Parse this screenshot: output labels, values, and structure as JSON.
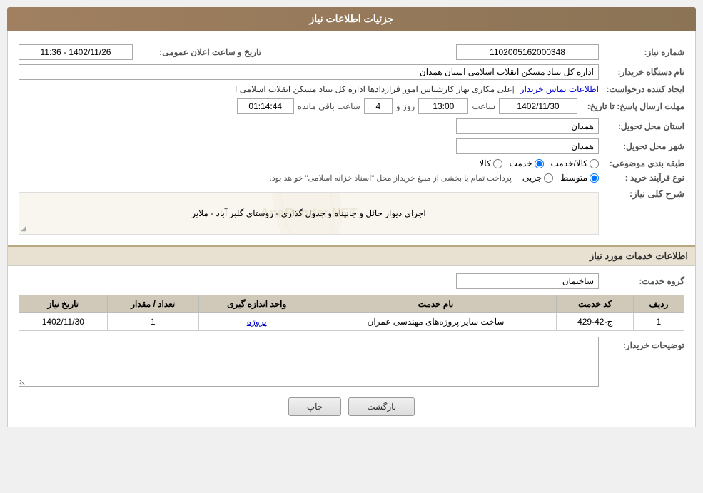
{
  "header": {
    "title": "جزئیات اطلاعات نیاز"
  },
  "form": {
    "need_number_label": "شماره نیاز:",
    "need_number_value": "1102005162000348",
    "announcement_time_label": "تاریخ و ساعت اعلان عمومی:",
    "announcement_time_value": "1402/11/26 - 11:36",
    "buyer_org_label": "نام دستگاه خریدار:",
    "buyer_org_value": "اداره کل بنیاد مسکن انقلاب اسلامی استان همدان",
    "creator_label": "ایجاد کننده درخواست:",
    "creator_value": "علی مکاری بهار کارشناس امور قراردادها اداره کل بنیاد مسکن انقلاب اسلامی ا",
    "creator_link": "اطلاعات تماس خریدار",
    "deadline_label": "مهلت ارسال پاسخ: تا تاریخ:",
    "deadline_date": "1402/11/30",
    "deadline_time_label": "ساعت",
    "deadline_time": "13:00",
    "deadline_day_label": "روز و",
    "deadline_days": "4",
    "remaining_label": "ساعت باقی مانده",
    "remaining_time": "01:14:44",
    "province_label": "استان محل تحویل:",
    "province_value": "همدان",
    "city_label": "شهر محل تحویل:",
    "city_value": "همدان",
    "category_label": "طبقه بندی موضوعی:",
    "category_options": [
      {
        "label": "کالا",
        "value": "kala"
      },
      {
        "label": "خدمت",
        "value": "khedmat"
      },
      {
        "label": "کالا/خدمت",
        "value": "kala_khedmat"
      }
    ],
    "category_selected": "khedmat",
    "purchase_type_label": "نوع فرآیند خرید :",
    "purchase_type_options": [
      {
        "label": "جزیی",
        "value": "jozi"
      },
      {
        "label": "متوسط",
        "value": "motavasset"
      }
    ],
    "purchase_type_selected": "motavasset",
    "purchase_type_note": "پرداخت تمام یا بخشی از مبلغ خریداز محل \"اسناد خزانه اسلامی\" خواهد بود.",
    "need_description_label": "شرح کلی نیاز:",
    "need_description_value": "اجرای دیوار حائل و جانپناه و جدول گذاری - روستای گلبر آباد - ملایر",
    "services_section_label": "اطلاعات خدمات مورد نیاز",
    "service_group_label": "گروه خدمت:",
    "service_group_value": "ساختمان",
    "table": {
      "columns": [
        "ردیف",
        "کد خدمت",
        "نام خدمت",
        "واحد اندازه گیری",
        "تعداد / مقدار",
        "تاریخ نیاز"
      ],
      "rows": [
        {
          "row": "1",
          "code": "ج-42-429",
          "name": "ساخت سایر پروژه‌های مهندسی عمران",
          "unit": "پروژه",
          "quantity": "1",
          "date": "1402/11/30"
        }
      ]
    },
    "buyer_notes_label": "توضیحات خریدار:",
    "buyer_notes_value": "",
    "print_button": "چاپ",
    "back_button": "بازگشت"
  }
}
